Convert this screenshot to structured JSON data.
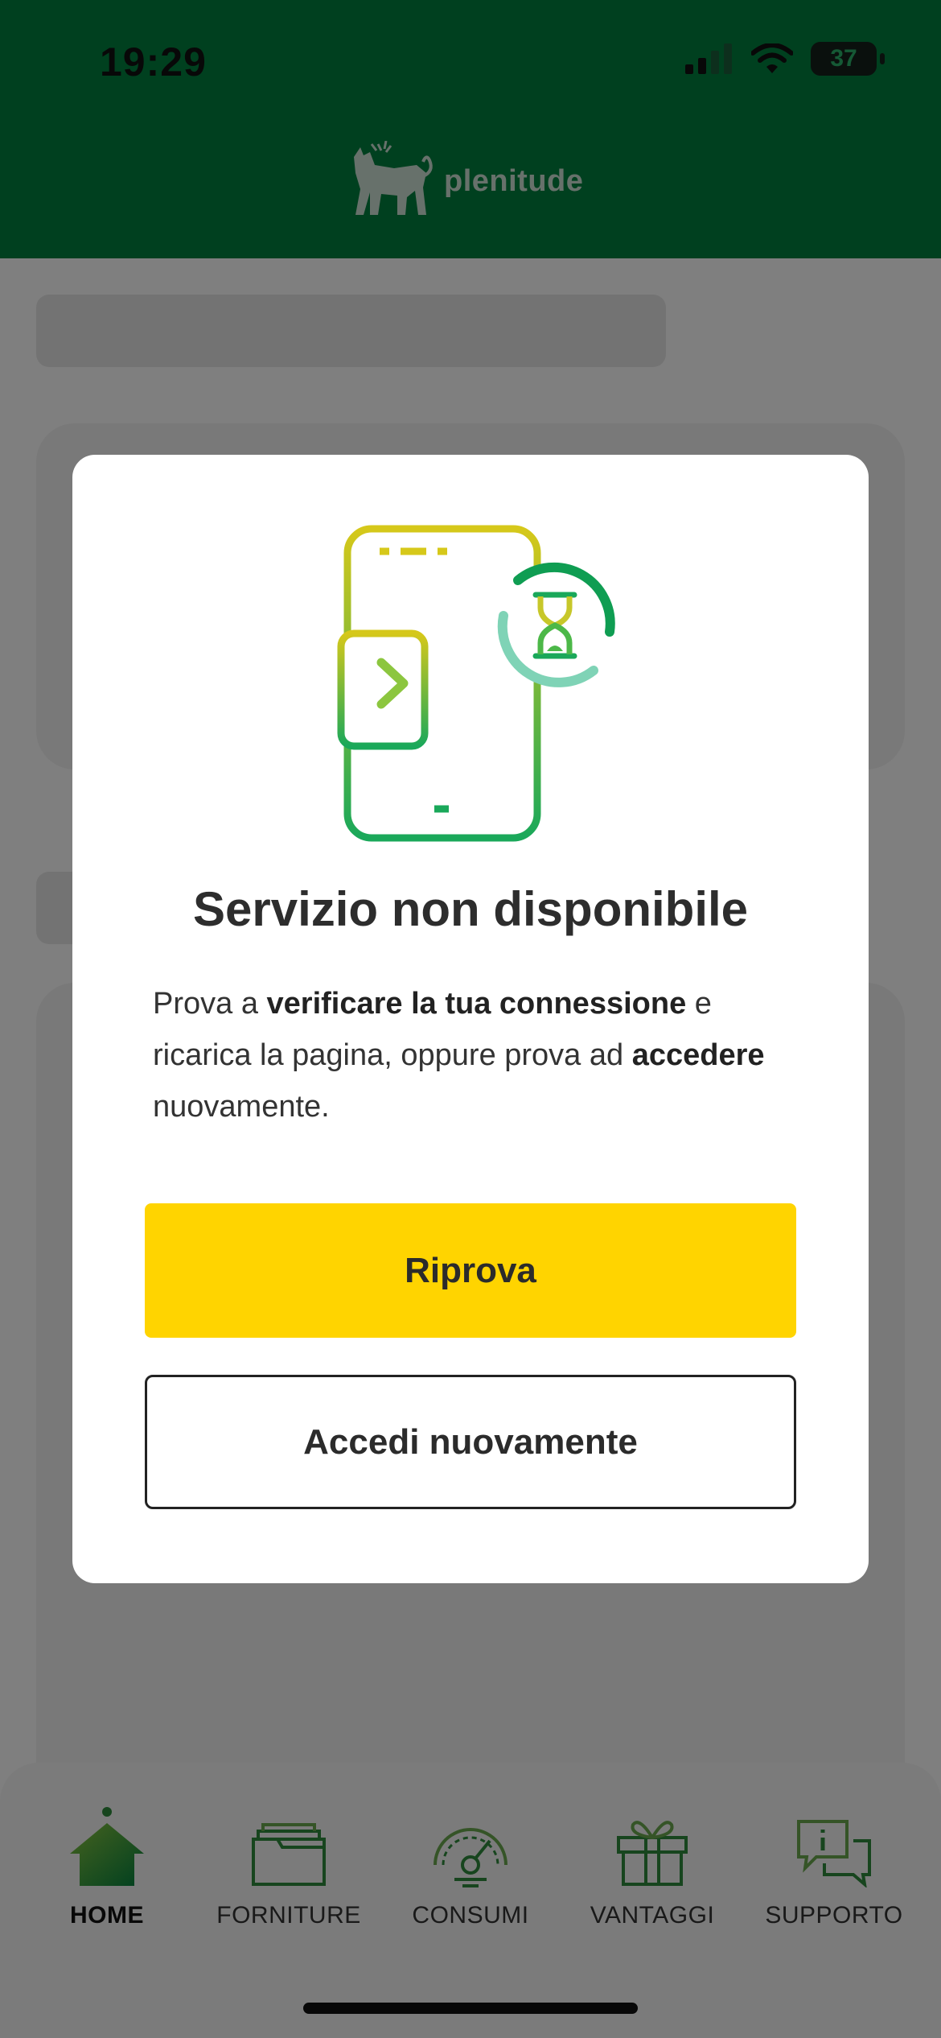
{
  "status_bar": {
    "time": "19:29",
    "battery_level": "37"
  },
  "brand": {
    "logo_text": "plenitude",
    "primary_color": "#00803f",
    "accent_color": "#ffd400"
  },
  "modal": {
    "illustration_icon": "phone-login-hourglass-icon",
    "title": "Servizio non disponibile",
    "body": {
      "part1": "Prova a ",
      "bold1": "verificare la tua connessione",
      "part2": " e ricarica la pagina, oppure prova ad ",
      "bold2": "accedere",
      "part3": " nuovamente."
    },
    "primary_button": "Riprova",
    "secondary_button": "Accedi nuovamente"
  },
  "tabbar": {
    "items": [
      {
        "label": "HOME",
        "icon": "home-icon",
        "active": true
      },
      {
        "label": "FORNITURE",
        "icon": "folder-icon",
        "active": false
      },
      {
        "label": "CONSUMI",
        "icon": "gauge-icon",
        "active": false
      },
      {
        "label": "VANTAGGI",
        "icon": "gift-icon",
        "active": false
      },
      {
        "label": "SUPPORTO",
        "icon": "chat-info-icon",
        "active": false
      }
    ]
  }
}
